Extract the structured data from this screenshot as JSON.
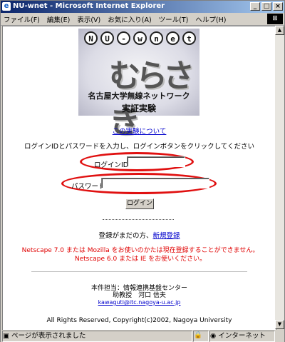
{
  "window": {
    "title": "NU-wnet - Microsoft Internet Explorer",
    "buttons": {
      "minimize": "_",
      "maximize": "□",
      "close": "×"
    }
  },
  "menu": {
    "items": [
      "ファイル(F)",
      "編集(E)",
      "表示(V)",
      "お気に入り(A)",
      "ツール(T)",
      "ヘルプ(H)"
    ]
  },
  "logo": {
    "letters": [
      "N",
      "U",
      "-",
      "w",
      "n",
      "e",
      "t"
    ],
    "kanji": "むらさき",
    "line1": "名古屋大学無線ネットワーク",
    "line2": "実証実験"
  },
  "page": {
    "about_link": "この実験について",
    "instruction": "ログインIDとパスワードを入力し、ログインボタンをクリックしてください",
    "login_id_label": "ログインID",
    "login_id_value": "",
    "password_label": "パスワード",
    "password_value": "",
    "login_button": "ログイン",
    "register_text": "登録がまだの方、",
    "register_link": "新規登録",
    "warning": "Netscape 7.0 または Mozilla をお使いのかたは現在登録することができません。Netscape 6.0 または IE をお使いください。",
    "contact_line1": "本件担当：情報連携基盤センター",
    "contact_line2": "助教授　河口 信夫",
    "contact_email": "kawaguti@itc.nagoya-u.ac.jp",
    "copyright": "All Rights Reserved, Copyright(c)2002, Nagoya University"
  },
  "status": {
    "left": "ページが表示されました",
    "zone": "インターネット"
  },
  "colors": {
    "highlight_oval": "#e01010",
    "link": "#0000cc",
    "warning": "#e00000"
  }
}
